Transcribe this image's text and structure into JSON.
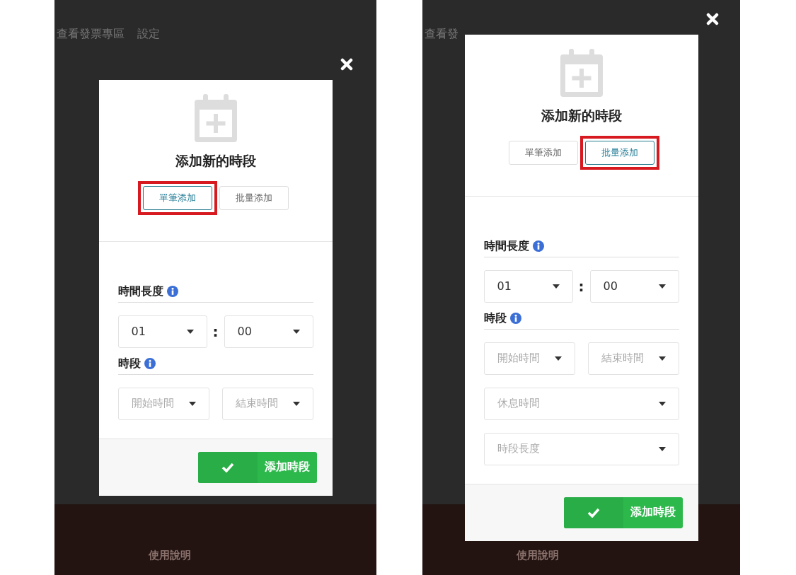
{
  "screens": [
    {
      "background_links": [
        "查看發票專區",
        "設定"
      ],
      "footer_text": "使用說明",
      "dialog": {
        "title": "添加新的時段",
        "modes": [
          {
            "label": "單筆添加",
            "selected": true,
            "highlighted": true
          },
          {
            "label": "批量添加",
            "selected": false,
            "highlighted": false
          }
        ],
        "duration": {
          "label": "時間長度",
          "hours": "01",
          "separator": ":",
          "minutes": "00"
        },
        "period": {
          "label": "時段",
          "fields": [
            {
              "placeholder": "開始時間",
              "kind": "half"
            },
            {
              "placeholder": "結束時間",
              "kind": "half"
            }
          ]
        },
        "submit": "添加時段"
      }
    },
    {
      "background_links": [
        "查看發"
      ],
      "footer_text": "使用說明",
      "dialog": {
        "title": "添加新的時段",
        "modes": [
          {
            "label": "單筆添加",
            "selected": false,
            "highlighted": false
          },
          {
            "label": "批量添加",
            "selected": true,
            "highlighted": true
          }
        ],
        "duration": {
          "label": "時間長度",
          "hours": "01",
          "separator": ":",
          "minutes": "00"
        },
        "period": {
          "label": "時段",
          "fields": [
            {
              "placeholder": "開始時間",
              "kind": "half"
            },
            {
              "placeholder": "結束時間",
              "kind": "half"
            },
            {
              "placeholder": "休息時間",
              "kind": "full"
            },
            {
              "placeholder": "時段長度",
              "kind": "full"
            }
          ]
        },
        "submit": "添加時段"
      }
    }
  ]
}
